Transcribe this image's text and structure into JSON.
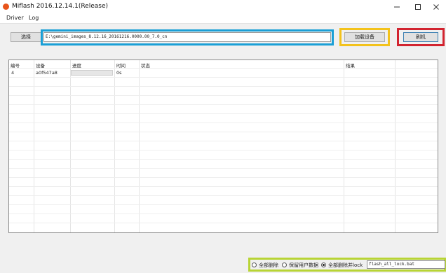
{
  "window": {
    "title": "Miflash 2016.12.14.1(Release)",
    "minimize_icon": "minimize-icon",
    "maximize_icon": "maximize-icon",
    "close_icon": "close-icon"
  },
  "menu": {
    "items": [
      "Driver",
      "Log"
    ]
  },
  "toolbar": {
    "select_label": "选择",
    "path_value": "E:\\gemini_images_8.12.16_20161216.0000.00_7.0_cn",
    "refresh_label": "加载设备",
    "flash_label": "刷机"
  },
  "table": {
    "columns": [
      "编号",
      "设备",
      "进度",
      "时间",
      "状态",
      "结果"
    ],
    "rows": [
      {
        "id": "4",
        "device": "a0f547a8",
        "progress": 0,
        "time": "0s",
        "status": "",
        "result": ""
      }
    ]
  },
  "options": {
    "clean_all_label": "全部删除",
    "save_user_data_label": "保留用户数据",
    "clean_all_lock_label": "全部删除并lock",
    "selected": "clean_all_lock",
    "script_value": "flash_all_lock.bat"
  },
  "colors": {
    "highlight_blue": "#1a9fd6",
    "highlight_yellow": "#f3c21b",
    "highlight_red": "#d22430",
    "highlight_green": "#b8d435",
    "app_icon": "#e8541b"
  }
}
